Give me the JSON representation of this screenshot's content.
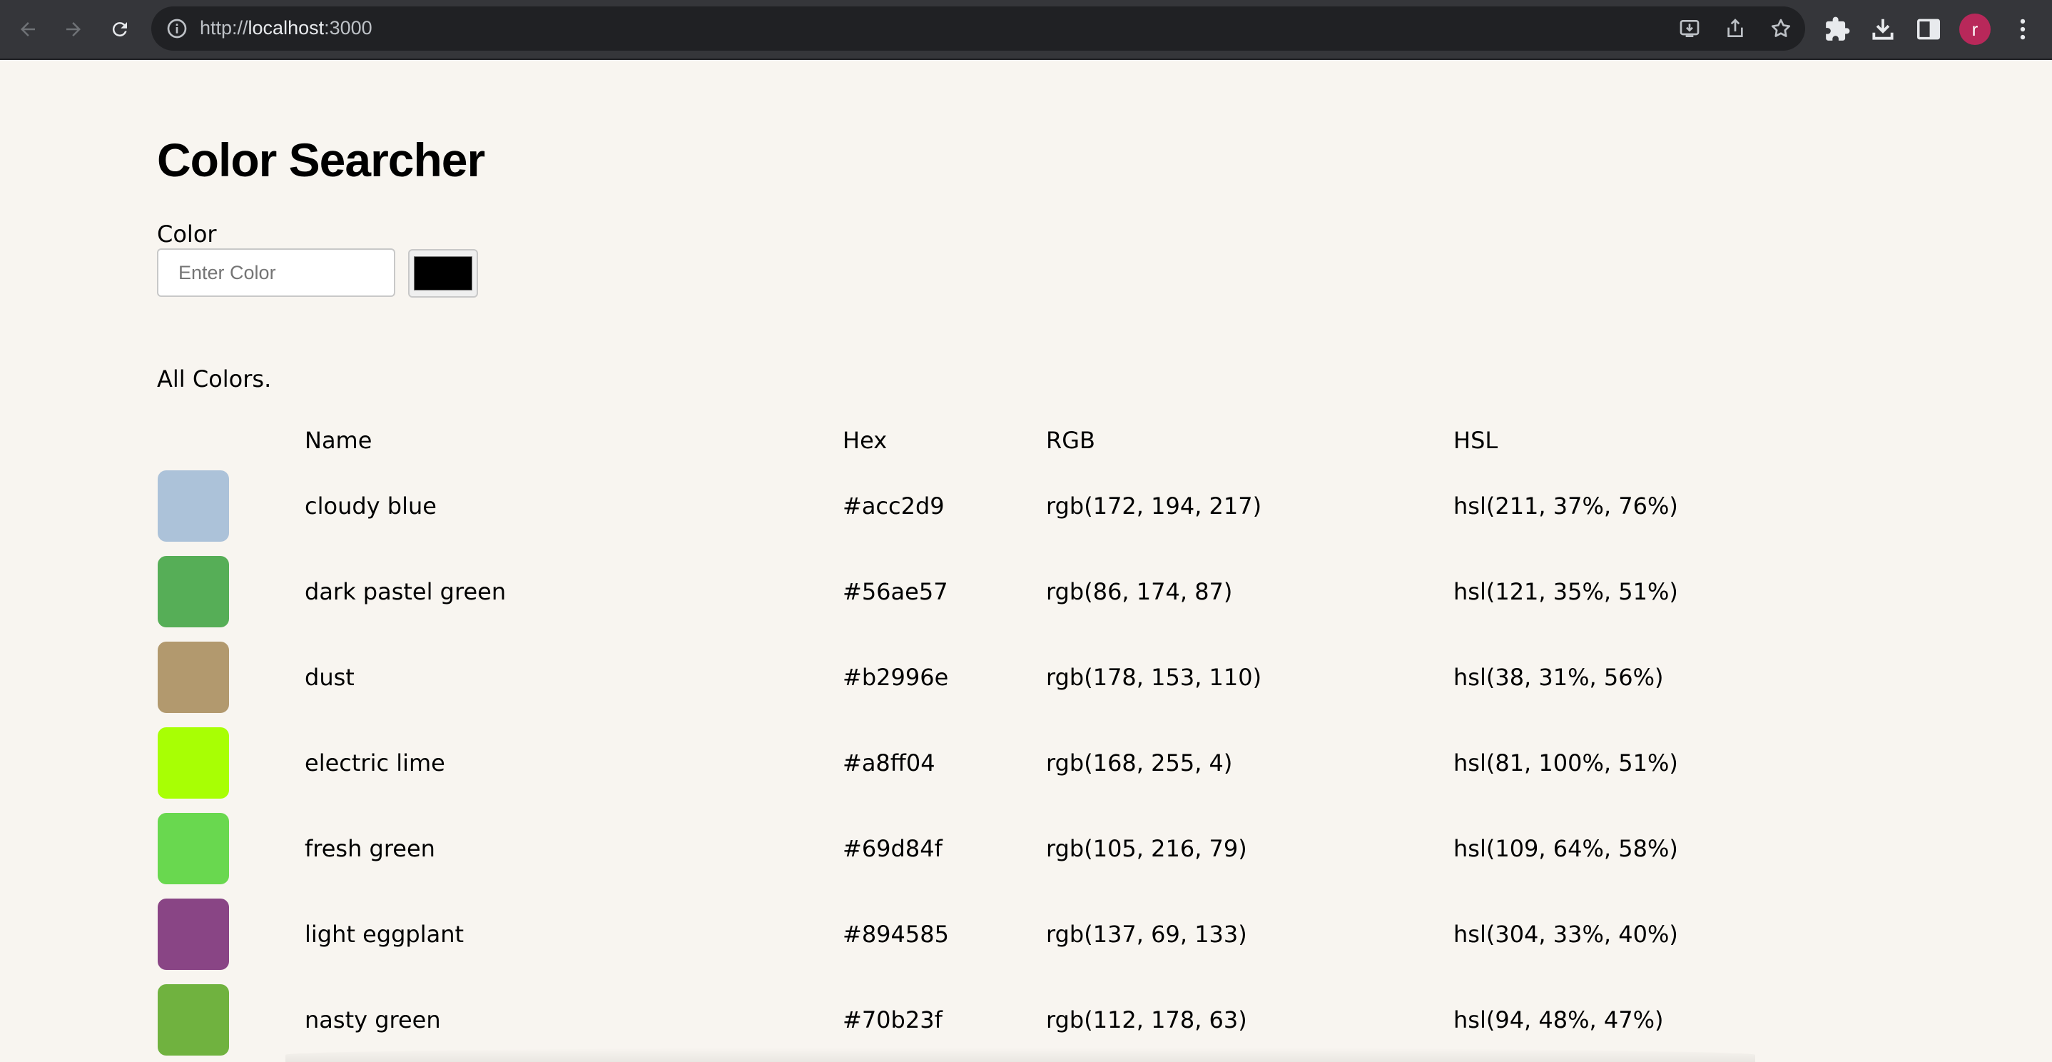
{
  "browser": {
    "url_scheme": "http://",
    "url_host": "localhost",
    "url_port": ":3000",
    "profile_initial": "r"
  },
  "page": {
    "title": "Color Searcher",
    "color_label": "Color",
    "color_placeholder": "Enter Color",
    "picker_value": "#000000",
    "list_heading": "All Colors."
  },
  "table": {
    "headers": {
      "name": "Name",
      "hex": "Hex",
      "rgb": "RGB",
      "hsl": "HSL"
    },
    "rows": [
      {
        "name": "cloudy blue",
        "hex": "#acc2d9",
        "rgb": "rgb(172, 194, 217)",
        "hsl": "hsl(211, 37%, 76%)"
      },
      {
        "name": "dark pastel green",
        "hex": "#56ae57",
        "rgb": "rgb(86, 174, 87)",
        "hsl": "hsl(121, 35%, 51%)"
      },
      {
        "name": "dust",
        "hex": "#b2996e",
        "rgb": "rgb(178, 153, 110)",
        "hsl": "hsl(38, 31%, 56%)"
      },
      {
        "name": "electric lime",
        "hex": "#a8ff04",
        "rgb": "rgb(168, 255, 4)",
        "hsl": "hsl(81, 100%, 51%)"
      },
      {
        "name": "fresh green",
        "hex": "#69d84f",
        "rgb": "rgb(105, 216, 79)",
        "hsl": "hsl(109, 64%, 58%)"
      },
      {
        "name": "light eggplant",
        "hex": "#894585",
        "rgb": "rgb(137, 69, 133)",
        "hsl": "hsl(304, 33%, 40%)"
      },
      {
        "name": "nasty green",
        "hex": "#70b23f",
        "rgb": "rgb(112, 178, 63)",
        "hsl": "hsl(94, 48%, 47%)"
      }
    ]
  }
}
